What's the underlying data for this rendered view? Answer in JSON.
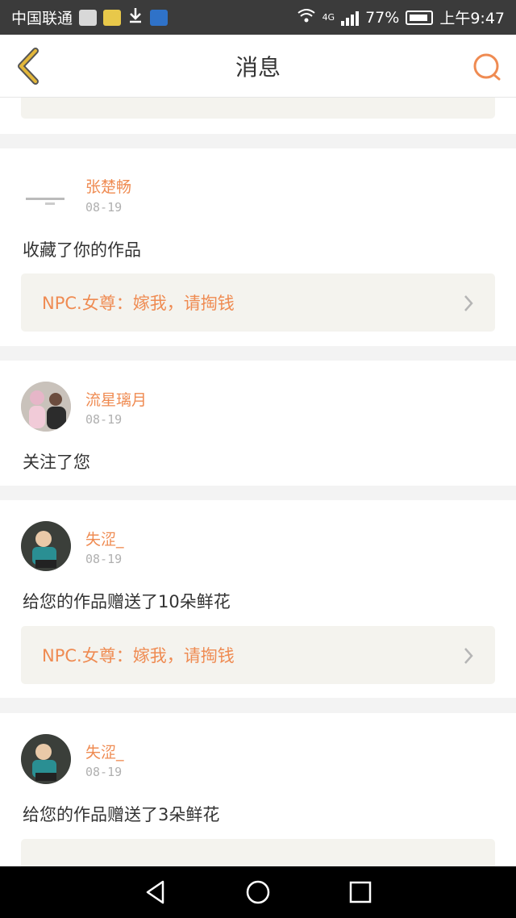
{
  "status_bar": {
    "carrier": "中国联通",
    "network": "4G",
    "battery": "77%",
    "time": "上午9:47"
  },
  "header": {
    "title": "消息"
  },
  "messages": [
    {
      "text": "—",
      "work": "…"
    },
    {
      "user": "张楚畅",
      "date": "08-19",
      "text": "收藏了你的作品",
      "work": "NPC.女尊：嫁我，请掏钱"
    },
    {
      "user": "流星璃月",
      "date": "08-19",
      "text": "关注了您"
    },
    {
      "user": "失涩_",
      "date": "08-19",
      "text": "给您的作品赠送了10朵鲜花",
      "work": "NPC.女尊：嫁我，请掏钱"
    },
    {
      "user": "失涩_",
      "date": "08-19",
      "text": "给您的作品赠送了3朵鲜花",
      "work": "…"
    }
  ],
  "colors": {
    "accent": "#ef8b52",
    "back_arrow": "#e3b73a",
    "work_box_bg": "#f4f3ee",
    "page_bg": "#f3f3f3"
  },
  "icons": {
    "back": "back-arrow-icon",
    "search": "search-icon",
    "chevron": "chevron-right-icon",
    "nav_back": "triangle-back-icon",
    "nav_home": "circle-home-icon",
    "nav_recent": "square-recent-icon"
  }
}
